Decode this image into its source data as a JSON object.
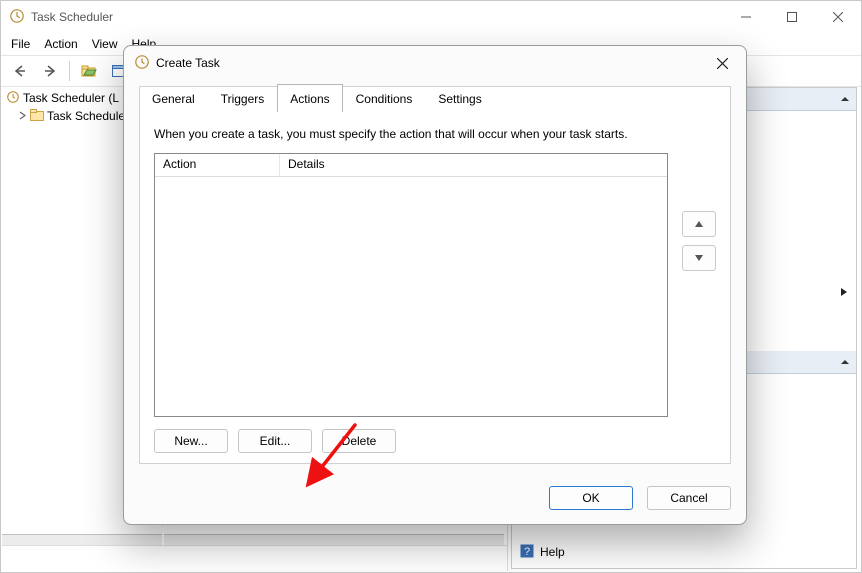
{
  "app": {
    "title": "Task Scheduler",
    "menus": [
      "File",
      "Action",
      "View",
      "Help"
    ]
  },
  "tree": {
    "root": "Task Scheduler (L",
    "child": "Task Schedule"
  },
  "rightPane": {
    "helpLabel": "Help"
  },
  "dialog": {
    "title": "Create Task",
    "tabs": {
      "general": "General",
      "triggers": "Triggers",
      "actions": "Actions",
      "conditions": "Conditions",
      "settings": "Settings"
    },
    "activeTab": "Actions",
    "actionsPage": {
      "description": "When you create a task, you must specify the action that will occur when your task starts.",
      "columns": {
        "action": "Action",
        "details": "Details"
      },
      "buttons": {
        "new": "New...",
        "edit": "Edit...",
        "delete": "Delete"
      }
    },
    "footer": {
      "ok": "OK",
      "cancel": "Cancel"
    }
  }
}
